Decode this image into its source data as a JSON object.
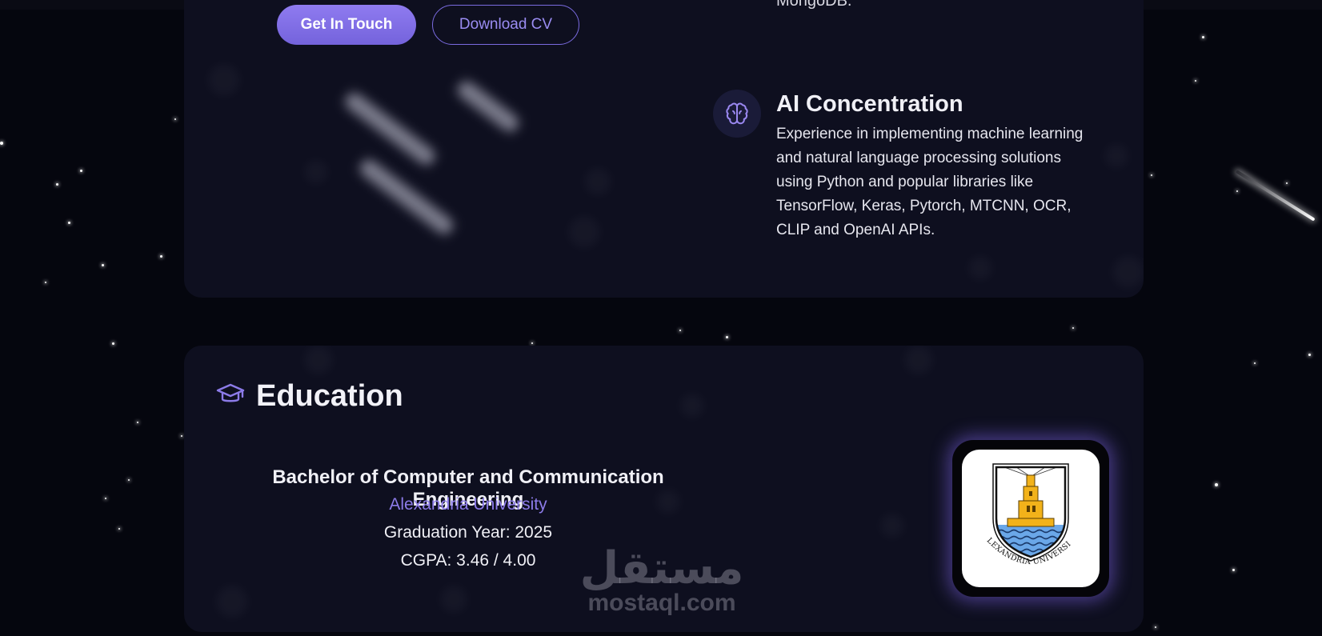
{
  "hero": {
    "get_in_touch_label": "Get In Touch",
    "download_cv_label": "Download CV",
    "cut_off_text": "MongoDB."
  },
  "feature": {
    "icon": "brain-icon",
    "title": "AI Concentration",
    "description": "Experience in implementing machine learning and natural language processing solutions using Python and popular libraries like TensorFlow, Keras, Pytorch, MTCNN, OCR, CLIP and OpenAI APIs."
  },
  "education": {
    "icon": "graduation-cap-icon",
    "title": "Education",
    "degree": "Bachelor of Computer and Communication Engineering",
    "university": "Alexandria University",
    "graduation": "Graduation Year: 2025",
    "cgpa": "CGPA: 3.46 / 4.00",
    "logo": "alexandria-university-logo",
    "logo_text": "ALEXANDRIA UNIVERSITY"
  },
  "watermark": {
    "arabic": "مستقل",
    "latin": "mostaql.com"
  },
  "colors": {
    "background": "#05060e",
    "card": "#0e0f1f",
    "accent": "#7f6ee6",
    "accent_text": "#8c7be8"
  }
}
